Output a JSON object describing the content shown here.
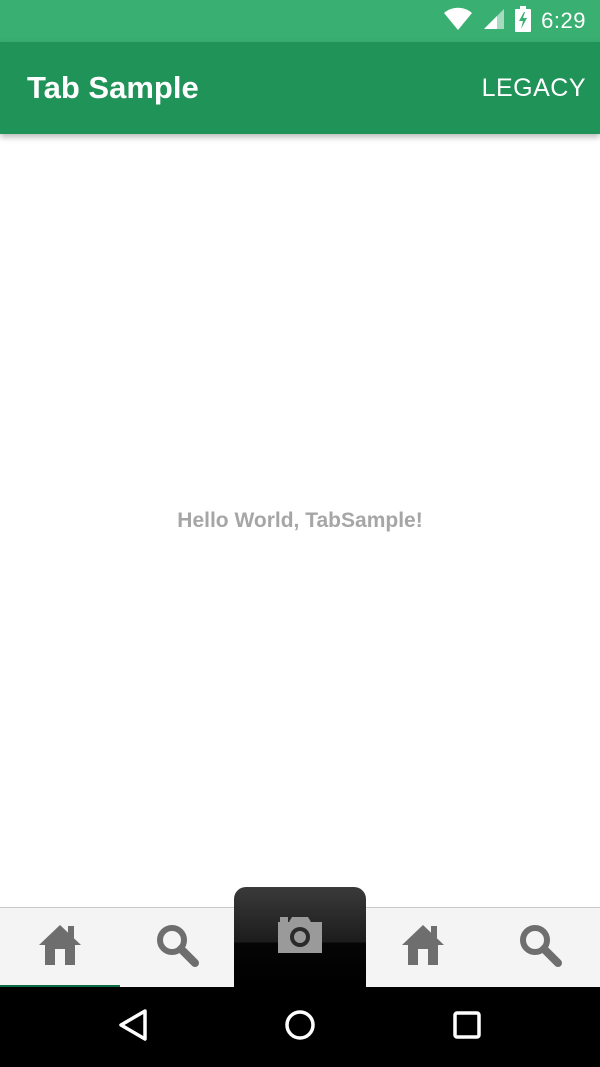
{
  "status_bar": {
    "time": "6:29",
    "icons": [
      "wifi-icon",
      "cell-signal-icon",
      "battery-icon"
    ],
    "background": "#3aaf72"
  },
  "app_bar": {
    "title": "Tab Sample",
    "action_label": "LEGACY",
    "background": "#1f9358"
  },
  "content": {
    "message": "Hello World, TabSample!"
  },
  "tabs": {
    "items": [
      {
        "icon": "home-icon",
        "selected": true
      },
      {
        "icon": "search-icon",
        "selected": false
      },
      {
        "icon": "camera-icon",
        "selected": false
      },
      {
        "icon": "home-icon",
        "selected": false
      },
      {
        "icon": "search-icon",
        "selected": false
      }
    ],
    "indicator_color": "#0d6b44"
  },
  "navigation_bar": {
    "buttons": [
      "back-icon",
      "home-circle-icon",
      "recents-icon"
    ]
  }
}
